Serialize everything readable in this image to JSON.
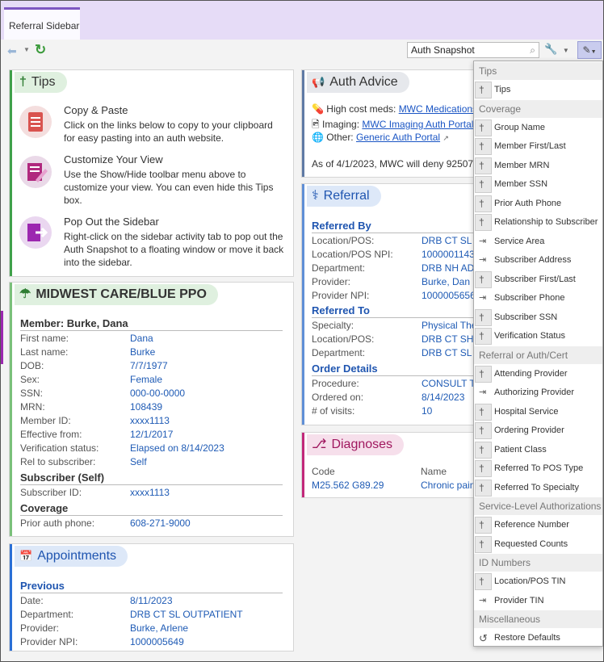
{
  "tab": {
    "label": "Referral Sidebar"
  },
  "toolbar": {
    "search_value": "Auth Snapshot"
  },
  "tips": {
    "title": "Tips",
    "items": [
      {
        "title": "Copy & Paste",
        "text": "Click on the links below to copy to your clipboard for easy pasting into an auth website."
      },
      {
        "title": "Customize Your View",
        "text": "Use the Show/Hide toolbar menu above to customize your view. You can even hide this Tips box."
      },
      {
        "title": "Pop Out the Sidebar",
        "text": "Right-click on the sidebar activity tab to pop out the Auth Snapshot to a floating window or move it back into the sidebar."
      }
    ]
  },
  "coverage": {
    "title": "MIDWEST CARE/BLUE PPO",
    "member_heading": "Member: Burke, Dana",
    "member_rows": [
      {
        "label": "First name:",
        "value": "Dana"
      },
      {
        "label": "Last name:",
        "value": "Burke"
      },
      {
        "label": "DOB:",
        "value": "7/7/1977"
      },
      {
        "label": "Sex:",
        "value": "Female"
      },
      {
        "label": "SSN:",
        "value": "000-00-0000"
      },
      {
        "label": "MRN:",
        "value": "108439"
      },
      {
        "label": "Member ID:",
        "value": "xxxx1113"
      },
      {
        "label": "Effective from:",
        "value": "12/1/2017"
      },
      {
        "label": "Verification status:",
        "value": "Elapsed on 8/14/2023"
      },
      {
        "label": "Rel to subscriber:",
        "value": "Self"
      }
    ],
    "subscriber_heading": "Subscriber (Self)",
    "subscriber_rows": [
      {
        "label": "Subscriber ID:",
        "value": "xxxx1113"
      }
    ],
    "coverage_heading": "Coverage",
    "coverage_rows": [
      {
        "label": "Prior auth phone:",
        "value": "608-271-9000"
      }
    ]
  },
  "appointments": {
    "title": "Appointments",
    "previous_heading": "Previous",
    "rows": [
      {
        "label": "Date:",
        "value": "8/11/2023"
      },
      {
        "label": "Department:",
        "value": "DRB CT SL OUTPATIENT"
      },
      {
        "label": "Provider:",
        "value": "Burke, Arlene"
      },
      {
        "label": "Provider NPI:",
        "value": "1000005649"
      }
    ]
  },
  "auth_advice": {
    "title": "Auth Advice",
    "lines": [
      {
        "prefix": "High cost meds:",
        "link": "MWC Medications"
      },
      {
        "prefix": "Imaging:",
        "link": "MWC Imaging Auth Portal"
      },
      {
        "prefix": "Other:",
        "link": "Generic Auth Portal"
      }
    ],
    "note": "As of 4/1/2023, MWC will deny 92507"
  },
  "referral": {
    "title": "Referral",
    "referred_by_heading": "Referred By",
    "referred_by": [
      {
        "label": "Location/POS:",
        "value": "DRB CT SL N"
      },
      {
        "label": "Location/POS NPI:",
        "value": "1000001143"
      },
      {
        "label": "Department:",
        "value": "DRB NH ADI"
      },
      {
        "label": "Provider:",
        "value": "Burke, Dan"
      },
      {
        "label": "Provider NPI:",
        "value": "1000005656"
      }
    ],
    "referred_to_heading": "Referred To",
    "referred_to": [
      {
        "label": "Specialty:",
        "value": "Physical The"
      },
      {
        "label": "Location/POS:",
        "value": "DRB CT SHO"
      },
      {
        "label": "Department:",
        "value": "DRB CT SL O"
      }
    ],
    "order_heading": "Order Details",
    "order": [
      {
        "label": "Procedure:",
        "value": "CONSULT TO"
      },
      {
        "label": "Ordered on:",
        "value": "8/14/2023"
      },
      {
        "label": "# of visits:",
        "value": "10"
      }
    ]
  },
  "diagnoses": {
    "title": "Diagnoses",
    "col_code": "Code",
    "col_name": "Name",
    "code": "M25.562 G89.29",
    "name": "Chronic pain"
  },
  "menu": {
    "entries": [
      {
        "type": "group",
        "label": "Tips"
      },
      {
        "type": "item",
        "label": "Tips",
        "pinned": true
      },
      {
        "type": "group",
        "label": "Coverage"
      },
      {
        "type": "item",
        "label": "Group Name",
        "pinned": true
      },
      {
        "type": "item",
        "label": "Member First/Last",
        "pinned": true
      },
      {
        "type": "item",
        "label": "Member MRN",
        "pinned": true
      },
      {
        "type": "item",
        "label": "Member SSN",
        "pinned": true
      },
      {
        "type": "item",
        "label": "Prior Auth Phone",
        "pinned": true
      },
      {
        "type": "item",
        "label": "Relationship to Subscriber",
        "pinned": true
      },
      {
        "type": "item",
        "label": "Service Area",
        "pinned": false
      },
      {
        "type": "item",
        "label": "Subscriber Address",
        "pinned": false
      },
      {
        "type": "item",
        "label": "Subscriber First/Last",
        "pinned": true
      },
      {
        "type": "item",
        "label": "Subscriber Phone",
        "pinned": false
      },
      {
        "type": "item",
        "label": "Subscriber SSN",
        "pinned": true
      },
      {
        "type": "item",
        "label": "Verification Status",
        "pinned": true
      },
      {
        "type": "group",
        "label": "Referral or Auth/Cert"
      },
      {
        "type": "item",
        "label": "Attending Provider",
        "pinned": true
      },
      {
        "type": "item",
        "label": "Authorizing Provider",
        "pinned": false
      },
      {
        "type": "item",
        "label": "Hospital Service",
        "pinned": true
      },
      {
        "type": "item",
        "label": "Ordering Provider",
        "pinned": true
      },
      {
        "type": "item",
        "label": "Patient Class",
        "pinned": true
      },
      {
        "type": "item",
        "label": "Referred To POS Type",
        "pinned": true
      },
      {
        "type": "item",
        "label": "Referred To Specialty",
        "pinned": true
      },
      {
        "type": "group",
        "label": "Service-Level Authorizations"
      },
      {
        "type": "item",
        "label": "Reference Number",
        "pinned": true
      },
      {
        "type": "item",
        "label": "Requested Counts",
        "pinned": true
      },
      {
        "type": "group",
        "label": "ID Numbers"
      },
      {
        "type": "item",
        "label": "Location/POS TIN",
        "pinned": true
      },
      {
        "type": "item",
        "label": "Provider TIN",
        "pinned": false
      },
      {
        "type": "group",
        "label": "Miscellaneous"
      },
      {
        "type": "item",
        "label": "Restore Defaults",
        "pinned": false,
        "restore": true
      }
    ]
  },
  "colors": {
    "tips_bar": "#3fa14a",
    "coverage_bar": "#7ac07a",
    "appointments_bar": "#2a6fd6",
    "referral_bar": "#5f8fd6",
    "diagnoses_bar": "#c2287a",
    "tab_accent": "#7e57c2"
  }
}
